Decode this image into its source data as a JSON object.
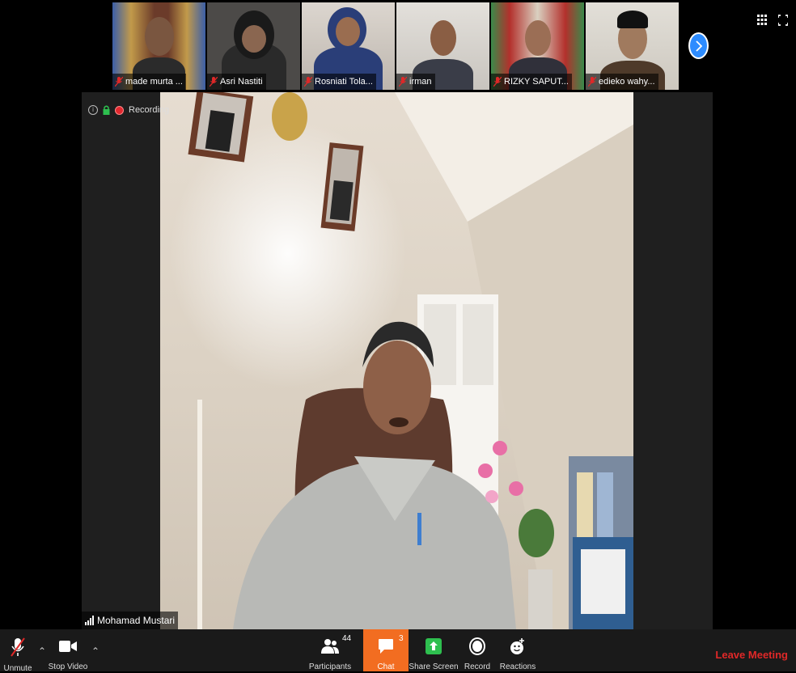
{
  "participants_strip": [
    {
      "name": "made murta ...",
      "bg": "#6b3b2a",
      "skin": "#7a5640",
      "shirt": "#2b2b2b"
    },
    {
      "name": "Asri Nastiti",
      "bg": "#4c4a48",
      "skin": "#1e1e1e",
      "shirt": "#2a2a2a"
    },
    {
      "name": "Rosniati Tola...",
      "bg": "#cfc8c0",
      "skin": "#9a6d50",
      "shirt": "#2a3e78"
    },
    {
      "name": "irman",
      "bg": "#d7d4cf",
      "skin": "#8a5e44",
      "shirt": "#3a3d48"
    },
    {
      "name": "RIZKY SAPUT...",
      "bg": "#3a8a4a",
      "skin": "#9b6e55",
      "shirt": "#30303a"
    },
    {
      "name": "edieko wahy...",
      "bg": "#d8d4cc",
      "skin": "#a07a5e",
      "shirt": "#4e3a2a"
    }
  ],
  "recording": {
    "label": "Recording"
  },
  "speaker": {
    "name": "Mohamad Mustari"
  },
  "toolbar": {
    "unmute": "Unmute",
    "stop_video": "Stop Video",
    "participants": "Participants",
    "participants_count": "44",
    "chat": "Chat",
    "chat_count": "3",
    "share_screen": "Share Screen",
    "record": "Record",
    "reactions": "Reactions",
    "leave": "Leave Meeting"
  },
  "colors": {
    "accent": "#2d8cff",
    "chat_active": "#f26d21",
    "leave": "#e02828",
    "share": "#2ebf4f",
    "recording": "#e2282f"
  }
}
